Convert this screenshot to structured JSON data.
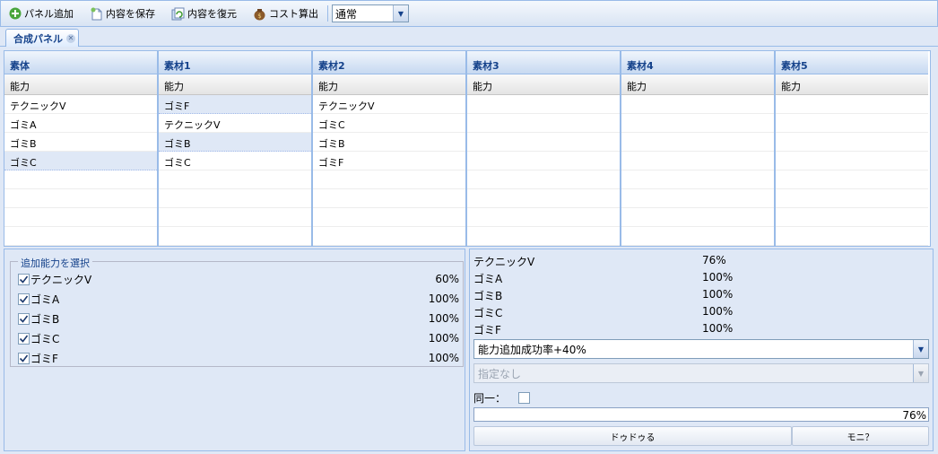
{
  "toolbar": {
    "add_panel": "パネル追加",
    "save": "内容を保存",
    "restore": "内容を復元",
    "cost": "コスト算出",
    "mode_select": "通常"
  },
  "tab": {
    "title": "合成パネル"
  },
  "grids": [
    {
      "title": "素体",
      "column": "能力",
      "rows": [
        "テクニックV",
        "ゴミA",
        "ゴミB",
        "ゴミC",
        "",
        "",
        "",
        ""
      ],
      "selected": [
        3
      ]
    },
    {
      "title": "素材1",
      "column": "能力",
      "rows": [
        "ゴミF",
        "テクニックV",
        "ゴミB",
        "ゴミC",
        "",
        "",
        "",
        ""
      ],
      "selected": [
        0,
        2
      ]
    },
    {
      "title": "素材2",
      "column": "能力",
      "rows": [
        "テクニックV",
        "ゴミC",
        "ゴミB",
        "ゴミF",
        "",
        "",
        "",
        ""
      ],
      "selected": []
    },
    {
      "title": "素材3",
      "column": "能力",
      "rows": [
        "",
        "",
        "",
        "",
        "",
        "",
        "",
        ""
      ],
      "selected": []
    },
    {
      "title": "素材4",
      "column": "能力",
      "rows": [
        "",
        "",
        "",
        "",
        "",
        "",
        "",
        ""
      ],
      "selected": []
    },
    {
      "title": "素材5",
      "column": "能力",
      "rows": [
        "",
        "",
        "",
        "",
        "",
        "",
        "",
        ""
      ],
      "selected": []
    }
  ],
  "options": {
    "legend": "追加能力を選択",
    "items": [
      {
        "label": "テクニックV",
        "pct": "60%",
        "checked": true
      },
      {
        "label": "ゴミA",
        "pct": "100%",
        "checked": true
      },
      {
        "label": "ゴミB",
        "pct": "100%",
        "checked": true
      },
      {
        "label": "ゴミC",
        "pct": "100%",
        "checked": true
      },
      {
        "label": "ゴミF",
        "pct": "100%",
        "checked": true
      }
    ]
  },
  "results": {
    "rows": [
      {
        "label": "テクニックV",
        "pct": "76%"
      },
      {
        "label": "ゴミA",
        "pct": "100%"
      },
      {
        "label": "ゴミB",
        "pct": "100%"
      },
      {
        "label": "ゴミC",
        "pct": "100%"
      },
      {
        "label": "ゴミF",
        "pct": "100%"
      }
    ],
    "bonus_select": "能力追加成功率+40%",
    "second_select": "指定なし",
    "same_label": "同一：",
    "same_checked": false,
    "progress_text": "76%",
    "progress_value": 0.76,
    "button1": "ドゥドゥる",
    "button2": "モニ？"
  },
  "colors": {
    "accent": "#15428b",
    "border": "#99bbe8",
    "background": "#dfe8f6"
  }
}
